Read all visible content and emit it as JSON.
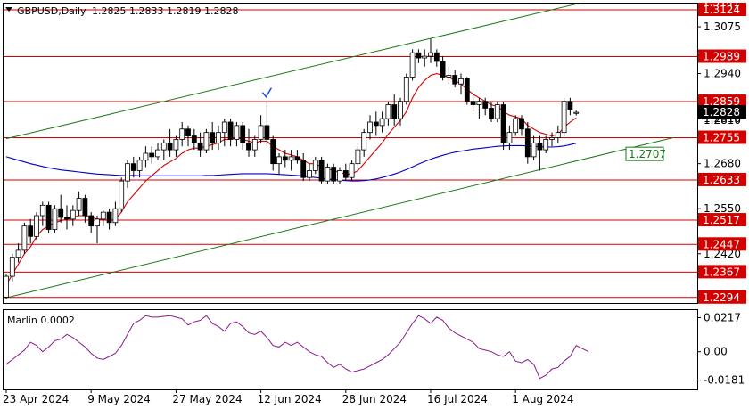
{
  "header": {
    "symbol": "GBPUSD,Daily",
    "ohlc": "1.2825 1.2833 1.2819 1.2828"
  },
  "colors": {
    "bull": "#ffffff",
    "bear": "#000000",
    "level": "#d40000",
    "level_label_bg": "#d40000",
    "current_label_bg": "#000000",
    "ma_red": "#d40000",
    "ma_blue": "#0000c8",
    "channel": "#1a7a1a",
    "oscillator": "#8b1a8b",
    "checkmark": "#1a4fd4"
  },
  "chart_data": [
    {
      "type": "candlestick",
      "title": "GBPUSD,Daily 1.2825 1.2833 1.2819 1.2828",
      "x": [
        "23 Apr 2024",
        "9 May 2024",
        "27 May 2024",
        "12 Jun 2024",
        "28 Jun 2024",
        "16 Jul 2024",
        "1 Aug 2024"
      ],
      "y_ticks": [
        "1.3075",
        "1.2940",
        "1.2810",
        "1.2680",
        "1.2550",
        "1.2420"
      ],
      "ylim": [
        1.2278,
        1.3142
      ],
      "levels": [
        "1.3124",
        "1.2989",
        "1.2859",
        "1.2755",
        "1.2633",
        "1.2517",
        "1.2447",
        "1.2367",
        "1.2294"
      ],
      "top_partial_label": "1.3141",
      "current_price": "1.2828",
      "hidden_label": "1.2810",
      "channel_label": "1.2707",
      "candles": [
        [
          1.2295,
          1.236,
          1.229,
          1.2355
        ],
        [
          1.2355,
          1.242,
          1.234,
          1.241
        ],
        [
          1.241,
          1.245,
          1.2395,
          1.243
        ],
        [
          1.243,
          1.251,
          1.242,
          1.25
        ],
        [
          1.25,
          1.252,
          1.245,
          1.247
        ],
        [
          1.247,
          1.254,
          1.246,
          1.253
        ],
        [
          1.253,
          1.257,
          1.25,
          1.256
        ],
        [
          1.256,
          1.257,
          1.248,
          1.249
        ],
        [
          1.249,
          1.256,
          1.248,
          1.255
        ],
        [
          1.255,
          1.259,
          1.251,
          1.2525
        ],
        [
          1.2525,
          1.256,
          1.249,
          1.252
        ],
        [
          1.252,
          1.256,
          1.25,
          1.2545
        ],
        [
          1.2545,
          1.26,
          1.253,
          1.258
        ],
        [
          1.258,
          1.259,
          1.251,
          1.253
        ],
        [
          1.253,
          1.254,
          1.248,
          1.25
        ],
        [
          1.25,
          1.253,
          1.245,
          1.252
        ],
        [
          1.252,
          1.2545,
          1.25,
          1.254
        ],
        [
          1.254,
          1.255,
          1.249,
          1.251
        ],
        [
          1.251,
          1.257,
          1.25,
          1.255
        ],
        [
          1.255,
          1.264,
          1.254,
          1.263
        ],
        [
          1.263,
          1.269,
          1.261,
          1.268
        ],
        [
          1.268,
          1.27,
          1.264,
          1.266
        ],
        [
          1.266,
          1.27,
          1.264,
          1.269
        ],
        [
          1.269,
          1.273,
          1.267,
          1.271
        ],
        [
          1.271,
          1.273,
          1.268,
          1.27
        ],
        [
          1.27,
          1.274,
          1.269,
          1.272
        ],
        [
          1.272,
          1.275,
          1.269,
          1.274
        ],
        [
          1.274,
          1.278,
          1.27,
          1.272
        ],
        [
          1.272,
          1.276,
          1.27,
          1.275
        ],
        [
          1.275,
          1.28,
          1.273,
          1.278
        ],
        [
          1.278,
          1.279,
          1.273,
          1.276
        ],
        [
          1.276,
          1.278,
          1.272,
          1.274
        ],
        [
          1.274,
          1.277,
          1.27,
          1.272
        ],
        [
          1.272,
          1.278,
          1.271,
          1.277
        ],
        [
          1.277,
          1.28,
          1.272,
          1.274
        ],
        [
          1.274,
          1.279,
          1.272,
          1.277
        ],
        [
          1.277,
          1.281,
          1.273,
          1.28
        ],
        [
          1.28,
          1.281,
          1.273,
          1.275
        ],
        [
          1.275,
          1.28,
          1.273,
          1.279
        ],
        [
          1.279,
          1.28,
          1.272,
          1.274
        ],
        [
          1.274,
          1.278,
          1.27,
          1.272
        ],
        [
          1.272,
          1.276,
          1.27,
          1.275
        ],
        [
          1.275,
          1.282,
          1.274,
          1.279
        ],
        [
          1.279,
          1.286,
          1.273,
          1.275
        ],
        [
          1.275,
          1.276,
          1.266,
          1.268
        ],
        [
          1.268,
          1.271,
          1.265,
          1.27
        ],
        [
          1.27,
          1.272,
          1.267,
          1.269
        ],
        [
          1.269,
          1.272,
          1.266,
          1.27
        ],
        [
          1.27,
          1.272,
          1.268,
          1.269
        ],
        [
          1.269,
          1.271,
          1.263,
          1.264
        ],
        [
          1.264,
          1.268,
          1.263,
          1.266
        ],
        [
          1.266,
          1.27,
          1.265,
          1.269
        ],
        [
          1.269,
          1.27,
          1.262,
          1.263
        ],
        [
          1.263,
          1.268,
          1.262,
          1.267
        ],
        [
          1.267,
          1.268,
          1.262,
          1.263
        ],
        [
          1.263,
          1.267,
          1.262,
          1.266
        ],
        [
          1.266,
          1.268,
          1.263,
          1.264
        ],
        [
          1.264,
          1.269,
          1.263,
          1.268
        ],
        [
          1.268,
          1.273,
          1.266,
          1.272
        ],
        [
          1.272,
          1.278,
          1.27,
          1.277
        ],
        [
          1.277,
          1.282,
          1.275,
          1.28
        ],
        [
          1.28,
          1.283,
          1.276,
          1.279
        ],
        [
          1.279,
          1.283,
          1.277,
          1.281
        ],
        [
          1.281,
          1.286,
          1.279,
          1.285
        ],
        [
          1.285,
          1.288,
          1.279,
          1.281
        ],
        [
          1.281,
          1.287,
          1.279,
          1.286
        ],
        [
          1.286,
          1.294,
          1.285,
          1.293
        ],
        [
          1.293,
          1.301,
          1.292,
          1.3
        ],
        [
          1.3,
          1.301,
          1.297,
          1.2985
        ],
        [
          1.2985,
          1.301,
          1.296,
          1.299
        ],
        [
          1.299,
          1.304,
          1.297,
          1.3
        ],
        [
          1.3,
          1.301,
          1.296,
          1.2975
        ],
        [
          1.2975,
          1.299,
          1.292,
          1.293
        ],
        [
          1.293,
          1.296,
          1.291,
          1.2935
        ],
        [
          1.2935,
          1.295,
          1.29,
          1.291
        ],
        [
          1.291,
          1.294,
          1.288,
          1.2925
        ],
        [
          1.2925,
          1.293,
          1.285,
          1.286
        ],
        [
          1.286,
          1.288,
          1.283,
          1.285
        ],
        [
          1.285,
          1.287,
          1.281,
          1.286
        ],
        [
          1.286,
          1.287,
          1.282,
          1.284
        ],
        [
          1.284,
          1.286,
          1.28,
          1.281
        ],
        [
          1.281,
          1.286,
          1.28,
          1.285
        ],
        [
          1.285,
          1.286,
          1.272,
          1.274
        ],
        [
          1.274,
          1.279,
          1.272,
          1.277
        ],
        [
          1.277,
          1.282,
          1.276,
          1.281
        ],
        [
          1.281,
          1.282,
          1.276,
          1.278
        ],
        [
          1.278,
          1.28,
          1.268,
          1.27
        ],
        [
          1.27,
          1.276,
          1.269,
          1.274
        ],
        [
          1.274,
          1.276,
          1.266,
          1.272
        ],
        [
          1.272,
          1.276,
          1.271,
          1.275
        ],
        [
          1.275,
          1.277,
          1.273,
          1.2755
        ],
        [
          1.2755,
          1.279,
          1.274,
          1.277
        ],
        [
          1.277,
          1.287,
          1.276,
          1.286
        ],
        [
          1.286,
          1.287,
          1.282,
          1.2835
        ],
        [
          1.2825,
          1.2833,
          1.2819,
          1.2828
        ]
      ],
      "ma_fast": [
        1.233,
        1.236,
        1.239,
        1.242,
        1.244,
        1.247,
        1.249,
        1.25,
        1.251,
        1.2515,
        1.252,
        1.2525,
        1.253,
        1.253,
        1.2525,
        1.252,
        1.252,
        1.2515,
        1.252,
        1.254,
        1.257,
        1.259,
        1.261,
        1.263,
        1.2645,
        1.266,
        1.2675,
        1.2685,
        1.2695,
        1.271,
        1.272,
        1.2725,
        1.2725,
        1.273,
        1.2735,
        1.274,
        1.275,
        1.275,
        1.2755,
        1.275,
        1.2745,
        1.274,
        1.2745,
        1.2745,
        1.273,
        1.272,
        1.271,
        1.2705,
        1.27,
        1.269,
        1.268,
        1.268,
        1.267,
        1.2665,
        1.266,
        1.2655,
        1.265,
        1.265,
        1.266,
        1.268,
        1.27,
        1.272,
        1.274,
        1.2765,
        1.2785,
        1.2805,
        1.283,
        1.287,
        1.29,
        1.292,
        1.2935,
        1.294,
        1.2935,
        1.293,
        1.292,
        1.291,
        1.2895,
        1.288,
        1.287,
        1.286,
        1.285,
        1.2845,
        1.283,
        1.282,
        1.2815,
        1.281,
        1.279,
        1.278,
        1.277,
        1.2765,
        1.276,
        1.2765,
        1.2785,
        1.28,
        1.2812
      ],
      "ma_slow": [
        1.27,
        1.2695,
        1.269,
        1.2685,
        1.268,
        1.2676,
        1.2672,
        1.2668,
        1.2665,
        1.2662,
        1.266,
        1.2658,
        1.2656,
        1.2654,
        1.2652,
        1.265,
        1.2649,
        1.2648,
        1.2647,
        1.2646,
        1.2646,
        1.2646,
        1.2645,
        1.2645,
        1.2645,
        1.2645,
        1.2645,
        1.2645,
        1.2645,
        1.2645,
        1.2645,
        1.2645,
        1.2645,
        1.2646,
        1.2646,
        1.2647,
        1.2648,
        1.2649,
        1.265,
        1.2651,
        1.2651,
        1.2651,
        1.2651,
        1.2651,
        1.265,
        1.2649,
        1.2648,
        1.2647,
        1.2646,
        1.2644,
        1.2642,
        1.264,
        1.2638,
        1.2636,
        1.2634,
        1.2632,
        1.2631,
        1.263,
        1.263,
        1.2631,
        1.2633,
        1.2636,
        1.264,
        1.2645,
        1.265,
        1.2656,
        1.2663,
        1.2671,
        1.2679,
        1.2686,
        1.2693,
        1.2699,
        1.2704,
        1.2709,
        1.2713,
        1.2716,
        1.2719,
        1.2722,
        1.2724,
        1.2726,
        1.2728,
        1.273,
        1.2731,
        1.2732,
        1.2732,
        1.2732,
        1.2731,
        1.273,
        1.2729,
        1.2728,
        1.2728,
        1.2729,
        1.2731,
        1.2735,
        1.2739
      ],
      "channel": {
        "upper": [
          [
            0,
            1.2752
          ],
          [
            96,
            1.3149
          ]
        ],
        "lower": [
          [
            0,
            1.2293
          ],
          [
            110,
            1.2755
          ]
        ]
      },
      "checkmark_index": 43
    },
    {
      "type": "line",
      "title": "Marlin 0.0002",
      "y_ticks": [
        "0.0217",
        "0.00",
        "-0.0181"
      ],
      "ylim": [
        -0.024,
        0.0265
      ],
      "series": [
        {
          "values": [
            -0.008,
            -0.005,
            -0.002,
            0.001,
            0.006,
            0.004,
            0.0,
            0.003,
            0.007,
            0.008,
            0.011,
            0.009,
            0.006,
            0.003,
            -0.001,
            -0.004,
            -0.005,
            -0.003,
            -0.001,
            0.004,
            0.011,
            0.018,
            0.02,
            0.023,
            0.022,
            0.022,
            0.0225,
            0.023,
            0.022,
            0.021,
            0.017,
            0.019,
            0.02,
            0.023,
            0.018,
            0.016,
            0.013,
            0.018,
            0.019,
            0.016,
            0.012,
            0.011,
            0.013,
            0.009,
            0.004,
            0.003,
            0.006,
            0.004,
            0.006,
            0.003,
            0.0,
            -0.002,
            -0.003,
            -0.007,
            -0.01,
            -0.008,
            -0.011,
            -0.013,
            -0.012,
            -0.011,
            -0.009,
            -0.007,
            -0.005,
            -0.002,
            0.002,
            0.006,
            0.012,
            0.018,
            0.023,
            0.021,
            0.018,
            0.022,
            0.02,
            0.015,
            0.012,
            0.01,
            0.008,
            0.006,
            0.002,
            0.001,
            0.0,
            -0.002,
            -0.003,
            0.0,
            -0.006,
            -0.007,
            -0.005,
            -0.008,
            -0.017,
            -0.015,
            -0.011,
            -0.01,
            -0.006,
            -0.003,
            0.004,
            0.002,
            0.0002
          ]
        }
      ]
    }
  ]
}
